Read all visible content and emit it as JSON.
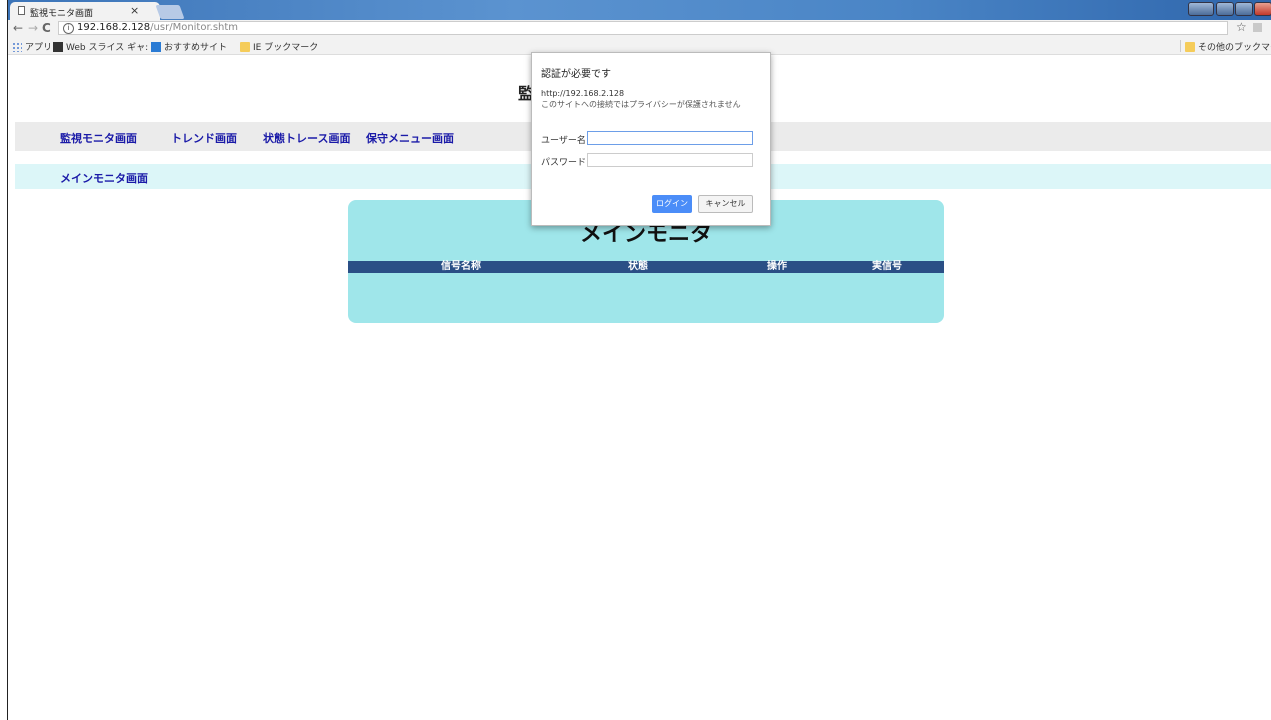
{
  "window": {
    "tab_title": "監視モニタ画面",
    "tab_close": "×"
  },
  "toolbar": {
    "back": "←",
    "forward": "→",
    "reload": "C",
    "info": "i",
    "url_host": "192.168.2.128",
    "url_path": "/usr/Monitor.shtm",
    "star": "☆",
    "menu": "⋮"
  },
  "bookmarks": {
    "apps": "アプリ",
    "web_slice": "Web スライス ギャ:",
    "recommended": "おすすめサイト",
    "ie_bookmarks": "IE ブックマーク",
    "other_bookmarks": "その他のブックマーク"
  },
  "page": {
    "title_partial": "監",
    "menu": [
      "監視モニタ画面",
      "トレンド画面",
      "状態トレース画面",
      "保守メニュー画面"
    ],
    "submenu": "メインモニタ画面",
    "panel_title": "メインモニタ",
    "table_headers": [
      "信号名称",
      "状態",
      "操作",
      "実信号"
    ]
  },
  "dialog": {
    "title": "認証が必要です",
    "url": "http://192.168.2.128",
    "warning": "このサイトへの接続ではプライバシーが保護されません",
    "username_label": "ユーザー名",
    "password_label": "パスワード",
    "login_button": "ログイン",
    "cancel_button": "キャンセル"
  }
}
